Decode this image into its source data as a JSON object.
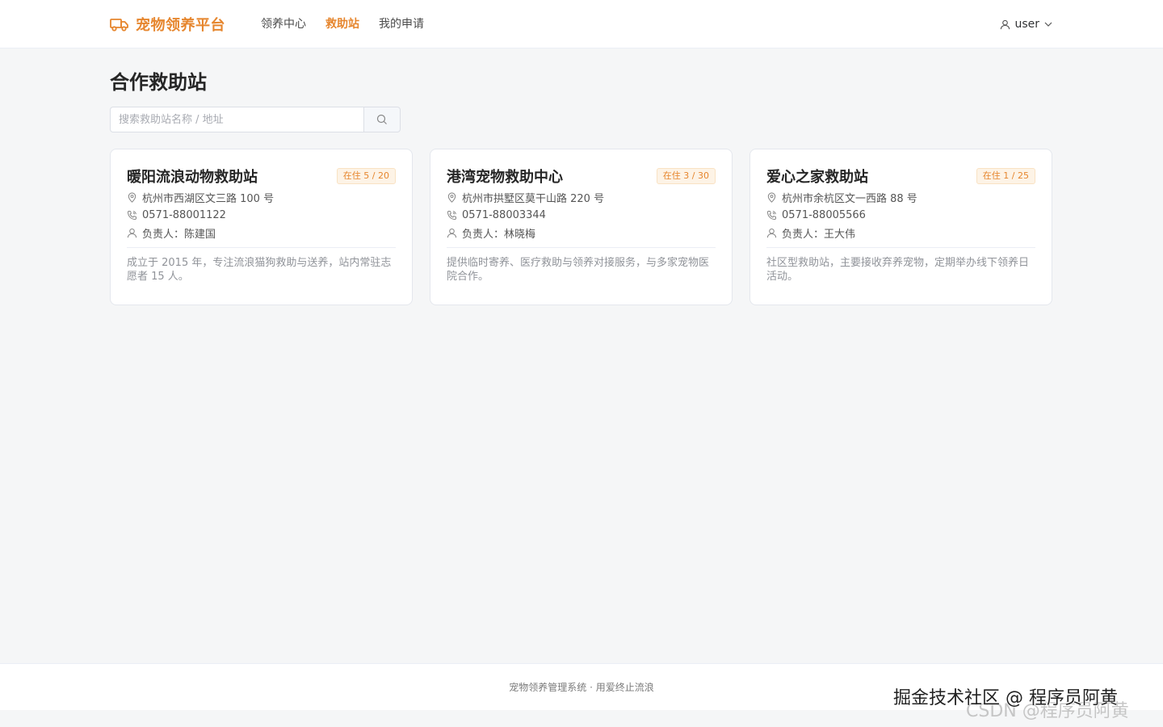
{
  "header": {
    "brand": "宠物领养平台",
    "nav": [
      "领养中心",
      "救助站",
      "我的申请"
    ],
    "active_nav": "救助站",
    "user": "user"
  },
  "main": {
    "title": "合作救助站",
    "search_placeholder": "搜索救助站名称 / 地址"
  },
  "stations": [
    {
      "name": "暖阳流浪动物救助站",
      "badge": "在住 5 / 20",
      "occupancy": 5,
      "capacity": 20,
      "address": "杭州市西湖区文三路 100 号",
      "phone": "0571-88001122",
      "manager": "负责人：陈建国",
      "desc": "成立于 2015 年，专注流浪猫狗救助与送养，站内常驻志愿者 15 人。"
    },
    {
      "name": "港湾宠物救助中心",
      "badge": "在住 3 / 30",
      "occupancy": 3,
      "capacity": 30,
      "address": "杭州市拱墅区莫干山路 220 号",
      "phone": "0571-88003344",
      "manager": "负责人：林晓梅",
      "desc": "提供临时寄养、医疗救助与领养对接服务，与多家宠物医院合作。"
    },
    {
      "name": "爱心之家救助站",
      "badge": "在住 1 / 25",
      "occupancy": 1,
      "capacity": 25,
      "address": "杭州市余杭区文一西路 88 号",
      "phone": "0571-88005566",
      "manager": "负责人：王大伟",
      "desc": "社区型救助站，主要接收弃养宠物，定期举办线下领养日活动。"
    }
  ],
  "footer": {
    "text": "宠物领养管理系统 · 用爱终止流浪"
  },
  "watermark": {
    "line1": "掘金技术社区 @ 程序员阿黄",
    "line2": "CSDN @程序员阿黄"
  },
  "colors": {
    "accent": "#e6862e",
    "background": "#f5f6f7",
    "card": "#ffffff"
  },
  "icons": {
    "brand": "truck-icon",
    "user": "user-icon",
    "dropdown": "chevron-down-icon",
    "search": "search-icon",
    "address": "location-pin-icon",
    "phone": "phone-icon",
    "manager": "user-icon"
  }
}
